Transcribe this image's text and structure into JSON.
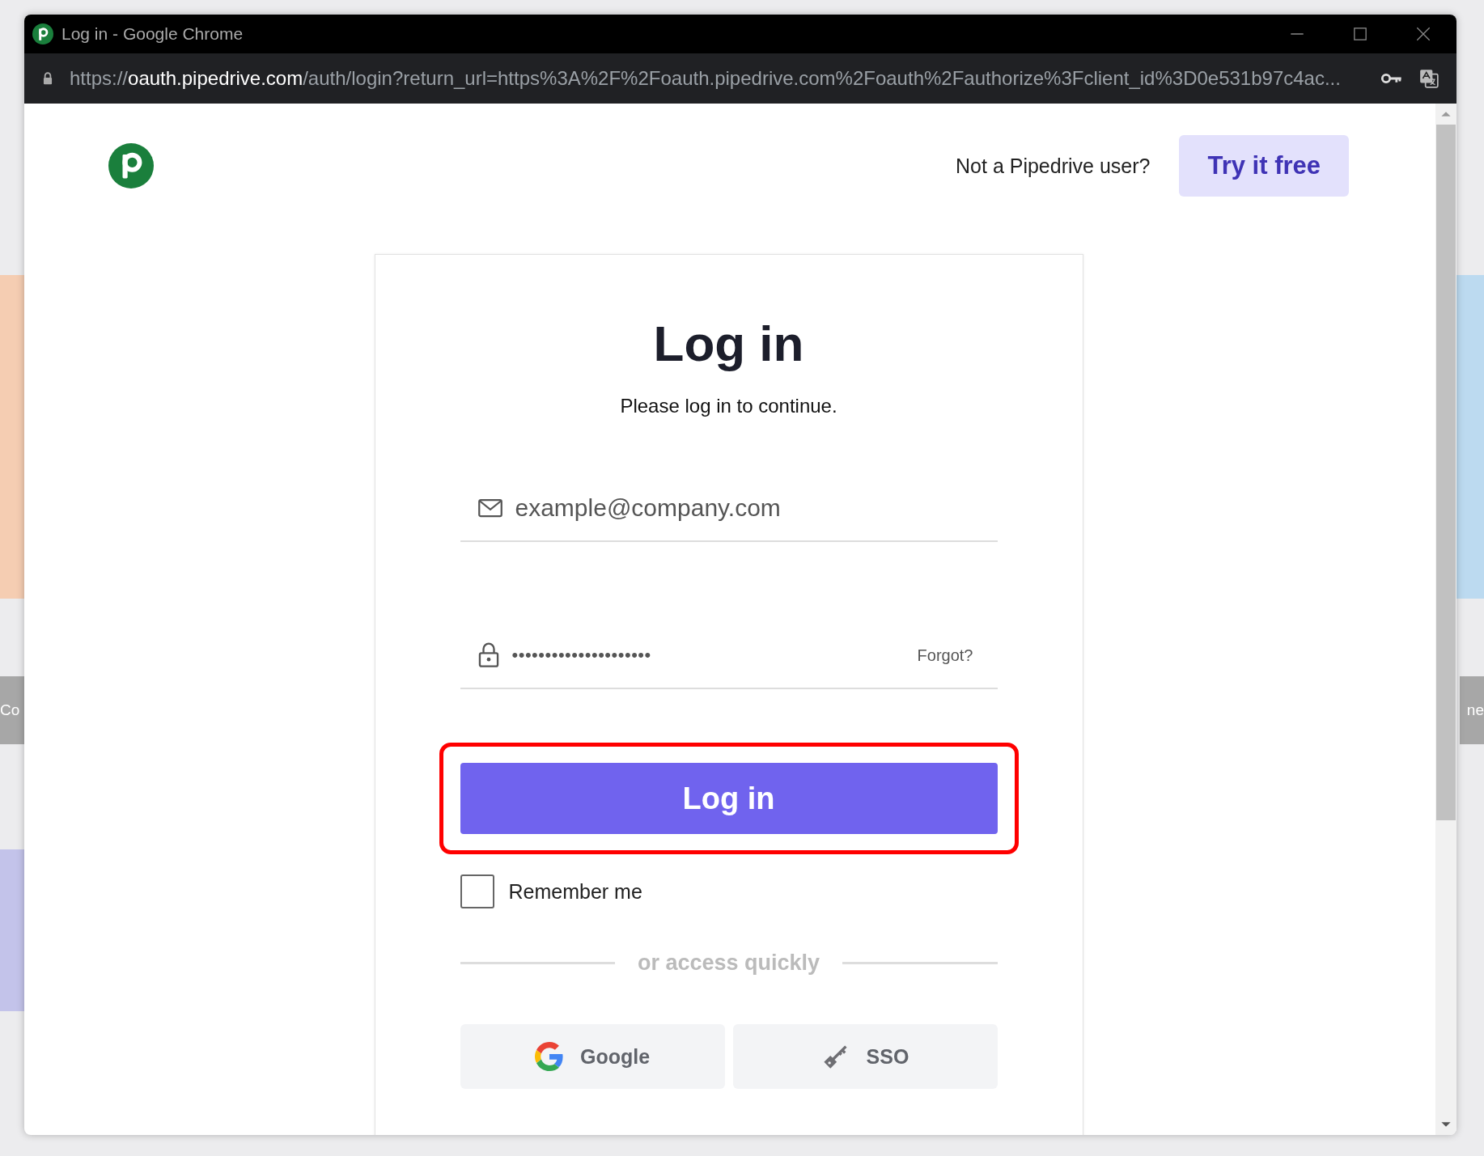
{
  "window": {
    "title": "Log in - Google Chrome"
  },
  "address_bar": {
    "scheme": "https://",
    "host": "oauth.pipedrive.com",
    "path": "/auth/login?return_url=https%3A%2F%2Foauth.pipedrive.com%2Foauth%2Fauthorize%3Fclient_id%3D0e531b97c4ac..."
  },
  "header": {
    "prompt": "Not a Pipedrive user?",
    "signup_button": "Try it free"
  },
  "form": {
    "title": "Log in",
    "subtitle": "Please log in to continue.",
    "email": {
      "placeholder": "example@company.com"
    },
    "password": {
      "value": "•••••••••••••••••••••",
      "forgot_link": "Forgot?"
    },
    "submit_button": "Log in",
    "submit_highlighted": true,
    "remember_me": {
      "label": "Remember me",
      "checked": false
    },
    "divider": "or access quickly",
    "quick_access": [
      {
        "kind": "google",
        "label": "Google"
      },
      {
        "kind": "sso",
        "label": "SSO"
      }
    ]
  },
  "background": {
    "left_fragment": "Co",
    "right_fragment": "ne"
  }
}
